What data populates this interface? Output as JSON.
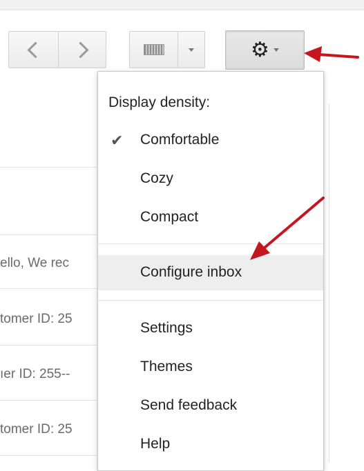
{
  "toolbar": {
    "prev_icon": "chevron-left-icon",
    "next_icon": "chevron-right-icon",
    "keyboard_icon": "keyboard-icon",
    "gear_icon": "gear-icon",
    "gear_glyph": "⚙"
  },
  "email_list": {
    "snippets": [
      "ello, We rec",
      "tomer ID: 25",
      "ıer ID: 255--",
      "tomer ID: 25"
    ]
  },
  "menu": {
    "header": "Display density:",
    "check_glyph": "✔",
    "density": [
      "Comfortable",
      "Cozy",
      "Compact"
    ],
    "configure": "Configure inbox",
    "items": [
      "Settings",
      "Themes",
      "Send feedback",
      "Help"
    ]
  },
  "colors": {
    "annotation_arrow": "#c4161c"
  }
}
